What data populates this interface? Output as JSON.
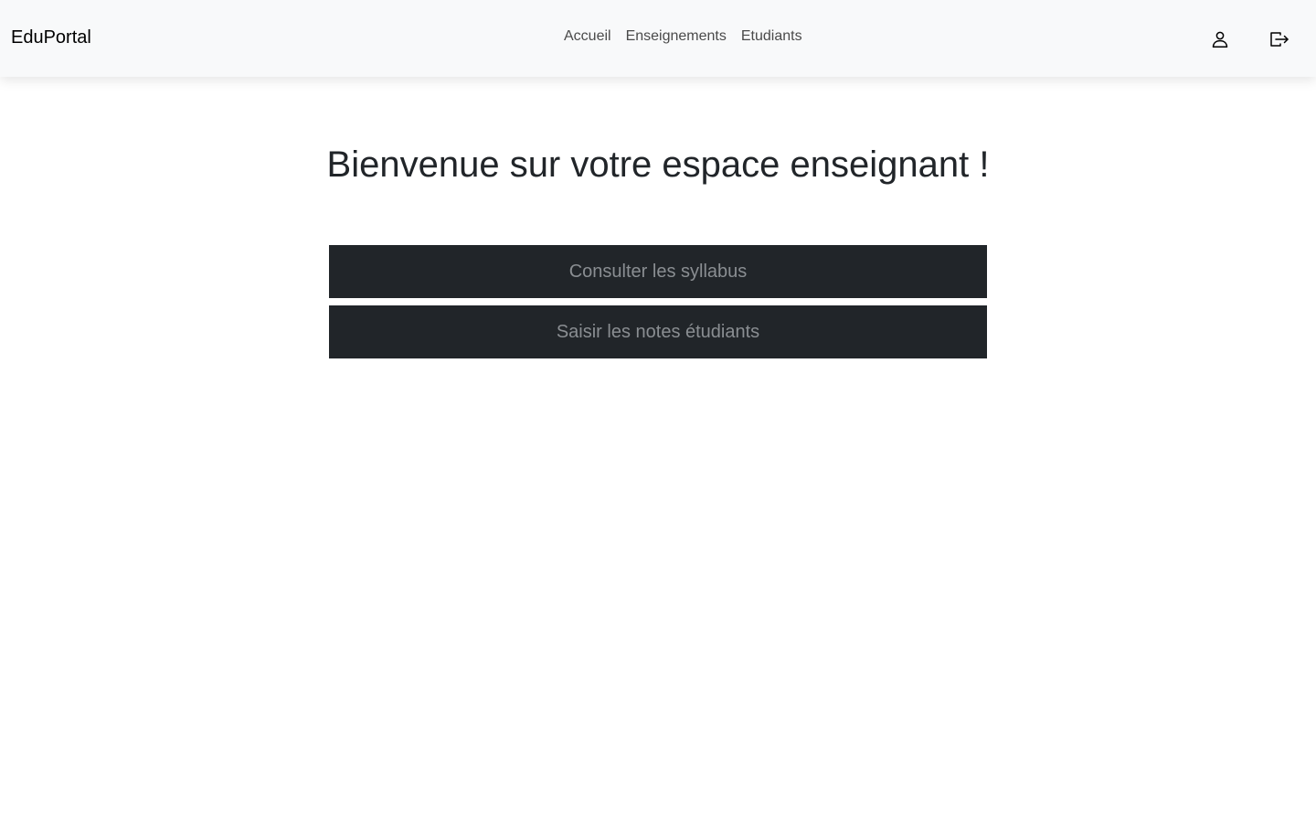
{
  "navbar": {
    "brand": "EduPortal",
    "links": [
      {
        "label": "Accueil"
      },
      {
        "label": "Enseignements"
      },
      {
        "label": "Etudiants"
      }
    ],
    "icons": {
      "profile": "user-icon",
      "logout": "logout-icon"
    }
  },
  "main": {
    "title": "Bienvenue sur votre espace enseignant !",
    "buttons": [
      {
        "label": "Consulter les syllabus"
      },
      {
        "label": "Saisir les notes étudiants"
      }
    ]
  },
  "colors": {
    "navbar_bg": "#f8f9fa",
    "button_bg": "#212529",
    "button_text": "#8a8e92",
    "title_text": "#212529"
  }
}
